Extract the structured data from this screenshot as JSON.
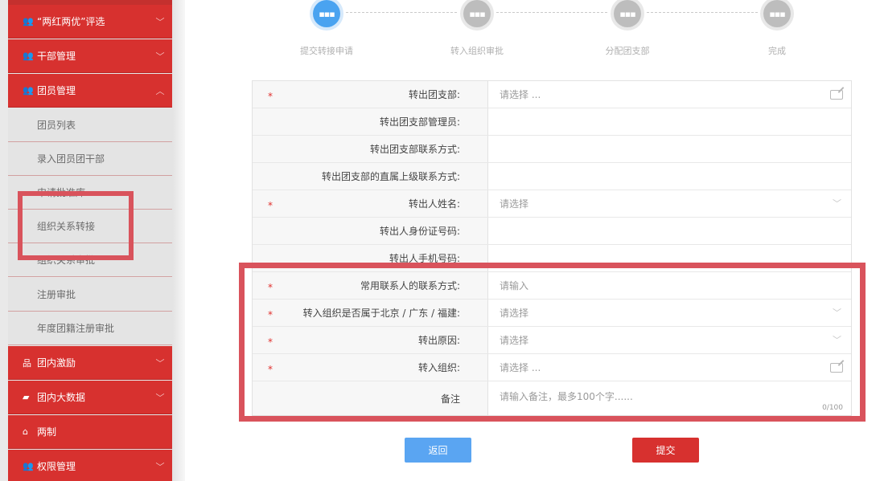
{
  "sidebar": {
    "items": [
      {
        "label": "“两红两优”评选",
        "icon": "users-icon",
        "chevron": "﹀",
        "type": "header"
      },
      {
        "label": "干部管理",
        "icon": "users-icon",
        "chevron": "﹀",
        "type": "header"
      },
      {
        "label": "团员管理",
        "icon": "users-icon",
        "chevron": "︿",
        "type": "header"
      },
      {
        "label": "团员列表",
        "type": "sub"
      },
      {
        "label": "录入团员团干部",
        "type": "sub"
      },
      {
        "label": "申请批准库",
        "type": "sub"
      },
      {
        "label": "组织关系转接",
        "type": "sub"
      },
      {
        "label": "组织关系审批",
        "type": "sub"
      },
      {
        "label": "注册审批",
        "type": "sub"
      },
      {
        "label": "年度团籍注册审批",
        "type": "sub"
      },
      {
        "label": "团内激励",
        "icon": "sitemap-icon",
        "chevron": "﹀",
        "type": "header"
      },
      {
        "label": "团内大数据",
        "icon": "folder-icon",
        "chevron": "﹀",
        "type": "header"
      },
      {
        "label": "两制",
        "icon": "home-icon",
        "chevron": "",
        "type": "header"
      },
      {
        "label": "权限管理",
        "icon": "users-icon",
        "chevron": "﹀",
        "type": "header"
      }
    ]
  },
  "steps": [
    {
      "label": "提交转接申请",
      "icon": "dots",
      "state": "active"
    },
    {
      "label": "转入组织审批",
      "icon": "dots",
      "state": "inactive"
    },
    {
      "label": "分配团支部",
      "icon": "dots",
      "state": "inactive"
    },
    {
      "label": "完成",
      "icon": "dots",
      "state": "inactive"
    }
  ],
  "icons": {
    "dots": "▪▪▪",
    "req": "*"
  },
  "form": {
    "rows": [
      {
        "label": "转出团支部:",
        "required": true,
        "placeholder": "请选择 ...",
        "control": "edit"
      },
      {
        "label": "转出团支部管理员:",
        "required": false,
        "placeholder": "",
        "control": "none"
      },
      {
        "label": "转出团支部联系方式:",
        "required": false,
        "placeholder": "",
        "control": "none"
      },
      {
        "label": "转出团支部的直属上级联系方式:",
        "required": false,
        "placeholder": "",
        "control": "none"
      },
      {
        "label": "转出人姓名:",
        "required": true,
        "placeholder": "请选择",
        "control": "select"
      },
      {
        "label": "转出人身份证号码:",
        "required": false,
        "placeholder": "",
        "control": "none"
      },
      {
        "label": "转出人手机号码:",
        "required": false,
        "placeholder": "",
        "control": "none"
      },
      {
        "label": "常用联系人的联系方式:",
        "required": true,
        "placeholder": "请输入",
        "control": "input"
      },
      {
        "label": "转入组织是否属于北京 / 广东 / 福建:",
        "required": true,
        "placeholder": "请选择",
        "control": "select"
      },
      {
        "label": "转出原因:",
        "required": true,
        "placeholder": "请选择",
        "control": "select"
      },
      {
        "label": "转入组织:",
        "required": true,
        "placeholder": "请选择 ...",
        "control": "edit"
      },
      {
        "label": "备注",
        "required": false,
        "placeholder": "请输入备注，最多100个字......",
        "control": "textarea",
        "counter": "0/100"
      }
    ]
  },
  "buttons": {
    "back": "返回",
    "submit": "提交"
  },
  "colors": {
    "primary_red": "#d7312f",
    "active_blue": "#4aa3f0",
    "highlight": "#d9535c"
  }
}
